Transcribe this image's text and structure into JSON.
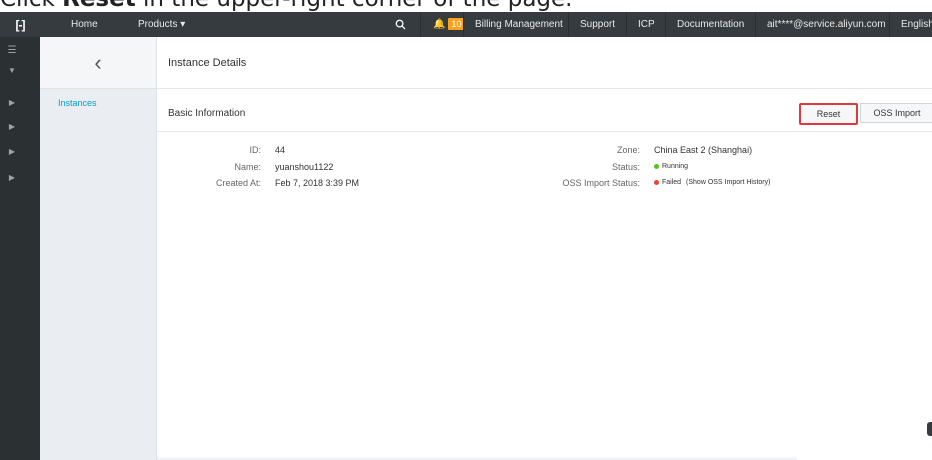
{
  "caption": {
    "prefix": "Click ",
    "bold": "Reset",
    "suffix": " in the upper-right corner of the page."
  },
  "topbar": {
    "logo": "[-]",
    "home": "Home",
    "products": "Products ▾",
    "notifications": "10",
    "billing": "Billing Management",
    "support": "Support",
    "icp": "ICP",
    "documentation": "Documentation",
    "account": "ait****@service.aliyun.com",
    "language": "English"
  },
  "sidebar": {
    "items": [
      {
        "label": "Instances"
      }
    ]
  },
  "page": {
    "title": "Instance Details"
  },
  "section": {
    "title": "Basic Information",
    "reset_label": "Reset",
    "oss_import_label": "OSS Import"
  },
  "info_left": [
    {
      "label": "ID:",
      "value": "44"
    },
    {
      "label": "Name:",
      "value": "yuanshou1122"
    },
    {
      "label": "Created At:",
      "value": "Feb 7, 2018 3:39 PM"
    }
  ],
  "info_right": {
    "zone_label": "Zone:",
    "zone_value": "China East 2 (Shanghai)",
    "status_label": "Status:",
    "status_value": "Running",
    "oss_label": "OSS Import Status:",
    "oss_value": "Failed",
    "oss_link": "(Show OSS Import History)"
  },
  "colors": {
    "running": "#52c41a",
    "failed": "#f04134",
    "accent": "#00a2ca",
    "highlight": "#e0383e"
  }
}
